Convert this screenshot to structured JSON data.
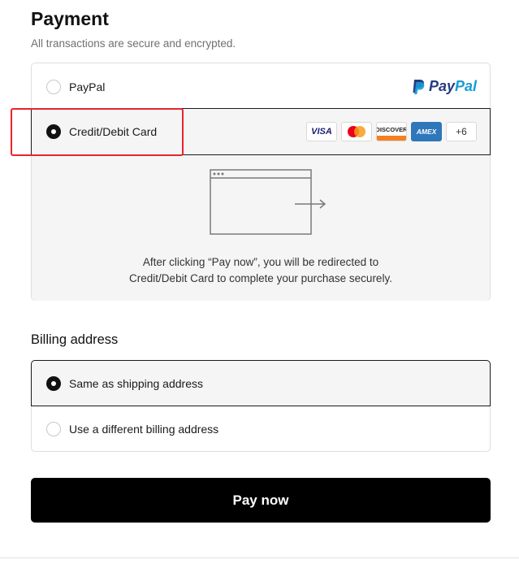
{
  "payment": {
    "title": "Payment",
    "subtitle": "All transactions are secure and encrypted.",
    "options": {
      "paypal": {
        "label": "PayPal",
        "logo_text_1": "Pay",
        "logo_text_2": "Pal",
        "selected": false
      },
      "card": {
        "label": "Credit/Debit Card",
        "selected": true,
        "brands": {
          "visa": "VISA",
          "discover": "DISCOVER",
          "amex": "AMEX",
          "more": "+6"
        },
        "icons": [
          "visa-icon",
          "mastercard-icon",
          "discover-icon",
          "amex-icon"
        ],
        "redirect_line_1": "After clicking “Pay now”, you will be redirected to",
        "redirect_line_2": "Credit/Debit Card to complete your purchase securely."
      }
    }
  },
  "billing": {
    "title": "Billing address",
    "options": {
      "same": {
        "label": "Same as shipping address",
        "selected": true
      },
      "different": {
        "label": "Use a different billing address",
        "selected": false
      }
    }
  },
  "pay_button": {
    "label": "Pay now"
  },
  "colors": {
    "accent": "#000000",
    "selected_bg": "#f5f5f5",
    "highlight": "#e8242b",
    "paypal_dark": "#253b80",
    "paypal_light": "#179bd7"
  }
}
